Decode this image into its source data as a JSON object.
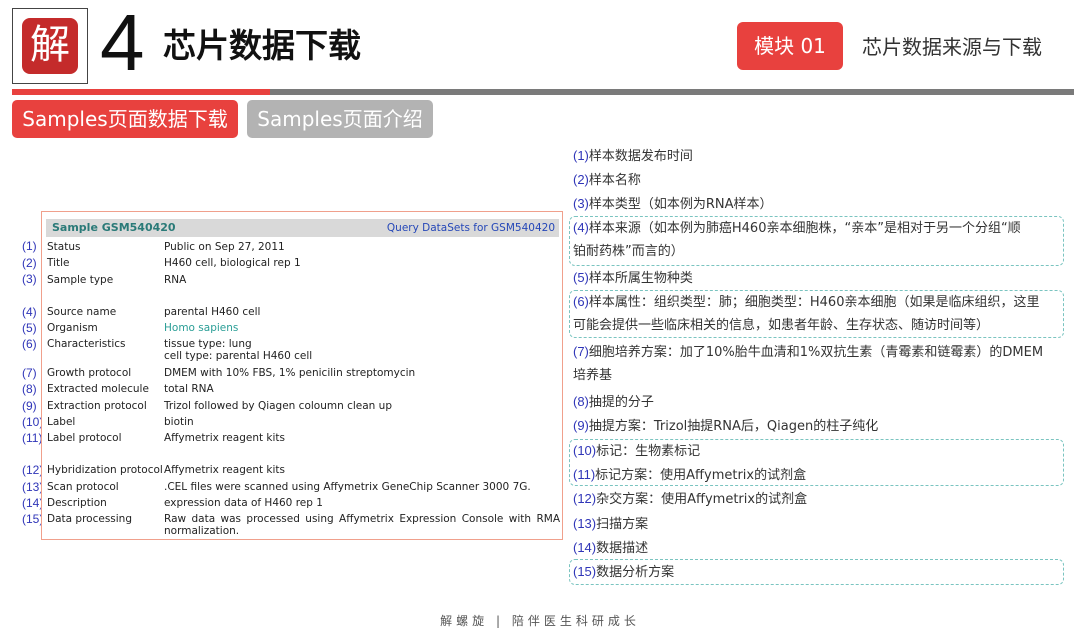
{
  "header": {
    "logo_char": "解",
    "page_number": "4",
    "title": "芯片数据下载",
    "module_badge": "模块 01",
    "module_name": "芯片数据来源与下载"
  },
  "tabs": [
    {
      "label": "Samples页面数据下载",
      "active": true
    },
    {
      "label": "Samples页面介绍",
      "active": false
    }
  ],
  "sample": {
    "title": "Sample GSM540420",
    "link": "Query DataSets for GSM540420",
    "fields": [
      {
        "num": "(1)",
        "label": "Status",
        "value": "Public on Sep 27, 2011"
      },
      {
        "num": "(2)",
        "label": "Title",
        "value": "H460 cell, biological rep 1"
      },
      {
        "num": "(3)",
        "label": "Sample type",
        "value": "RNA"
      },
      {
        "num": "(4)",
        "label": "Source name",
        "value": "parental H460 cell"
      },
      {
        "num": "(5)",
        "label": "Organism",
        "value": "Homo sapiens"
      },
      {
        "num": "(6)",
        "label": "Characteristics",
        "value": "tissue type: lung",
        "value2": "cell type: parental H460 cell"
      },
      {
        "num": "(7)",
        "label": "Growth protocol",
        "value": "DMEM with 10% FBS, 1% penicilin streptomycin"
      },
      {
        "num": "(8)",
        "label": "Extracted molecule",
        "value": "total RNA"
      },
      {
        "num": "(9)",
        "label": "Extraction protocol",
        "value": "Trizol followed by Qiagen coloumn clean up"
      },
      {
        "num": "(10)",
        "label": "Label",
        "value": "biotin"
      },
      {
        "num": "(11)",
        "label": "Label protocol",
        "value": "Affymetrix reagent kits"
      },
      {
        "num": "(12)",
        "label": "Hybridization protocol",
        "value": "Affymetrix reagent kits"
      },
      {
        "num": "(13)",
        "label": "Scan protocol",
        "value": ".CEL files were scanned using Affymetrix GeneChip Scanner 3000 7G."
      },
      {
        "num": "(14)",
        "label": "Description",
        "value": "expression data of H460 rep 1"
      },
      {
        "num": "(15)",
        "label": "Data processing",
        "value": "Raw data was processed using Affymetrix Expression Console with RMA normalization."
      }
    ]
  },
  "annotations": [
    {
      "num": "(1)",
      "text": "样本数据发布时间"
    },
    {
      "num": "(2)",
      "text": "样本名称"
    },
    {
      "num": "(3)",
      "text": "样本类型（如本例为RNA样本）"
    },
    {
      "num": "(4)",
      "text": "样本来源（如本例为肺癌H460亲本细胞株，“亲本”是相对于另一个分组“顺",
      "text2": "铂耐药株”而言的）"
    },
    {
      "num": "(5)",
      "text": "样本所属生物种类"
    },
    {
      "num": "(6)",
      "text": "样本属性：组织类型：肺；细胞类型：H460亲本细胞（如果是临床组织，这里",
      "text2": "可能会提供一些临床相关的信息，如患者年龄、生存状态、随访时间等）"
    },
    {
      "num": "(7)",
      "text": "细胞培养方案：加了10%胎牛血清和1%双抗生素（青霉素和链霉素）的DMEM",
      "text2": "培养基"
    },
    {
      "num": "(8)",
      "text": "抽提的分子"
    },
    {
      "num": "(9)",
      "text": "抽提方案：Trizol抽提RNA后，Qiagen的柱子纯化"
    },
    {
      "num": "(10)",
      "text": "标记：生物素标记"
    },
    {
      "num": "(11)",
      "text": "标记方案：使用Affymetrix的试剂盒"
    },
    {
      "num": "(12)",
      "text": "杂交方案：使用Affymetrix的试剂盒"
    },
    {
      "num": "(13)",
      "text": "扫描方案"
    },
    {
      "num": "(14)",
      "text": "数据描述"
    },
    {
      "num": "(15)",
      "text": "数据分析方案"
    }
  ],
  "footer": "解螺旋  |  陪伴医生科研成长",
  "colors": {
    "accent": "#e8413e",
    "gray_tab": "#b3b3b3",
    "number_blue": "#2f35b8",
    "link_teal": "#2a9e96",
    "dash_teal": "#7ac4c0"
  }
}
